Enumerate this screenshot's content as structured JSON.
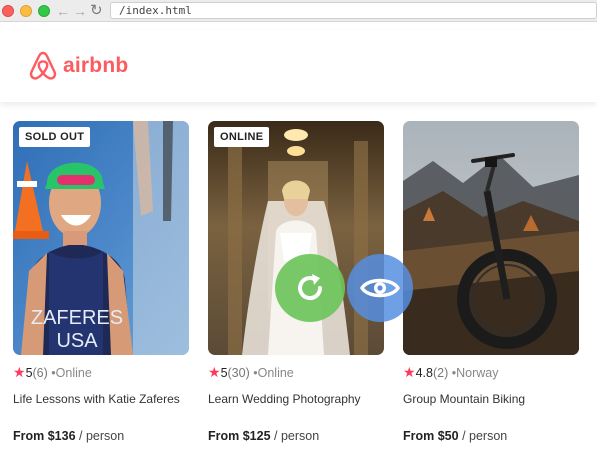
{
  "browser": {
    "url": "/index.html"
  },
  "brand": {
    "name": "airbnb",
    "color": "#ff5a5f"
  },
  "cards": [
    {
      "badge": "SOLD OUT",
      "rating": "5",
      "reviews": "(6)",
      "location": "•Online",
      "title": "Life Lessons with Katie Zaferes",
      "price": "From $136",
      "unit": "/ person"
    },
    {
      "badge": "ONLINE",
      "rating": "5",
      "reviews": "(30)",
      "location": "•Online",
      "title": "Learn Wedding Photography",
      "price": "From $125",
      "unit": "/ person"
    },
    {
      "rating": "4.8",
      "reviews": "(2)",
      "location": "•Norway",
      "title": "Group Mountain Biking",
      "price": "From $50",
      "unit": "/ person"
    }
  ],
  "photo1_text": {
    "line1": "ZAFERES",
    "line2": "USA"
  },
  "icons": {
    "star": "star-icon",
    "refresh": "refresh-icon",
    "view": "eye-icon"
  }
}
